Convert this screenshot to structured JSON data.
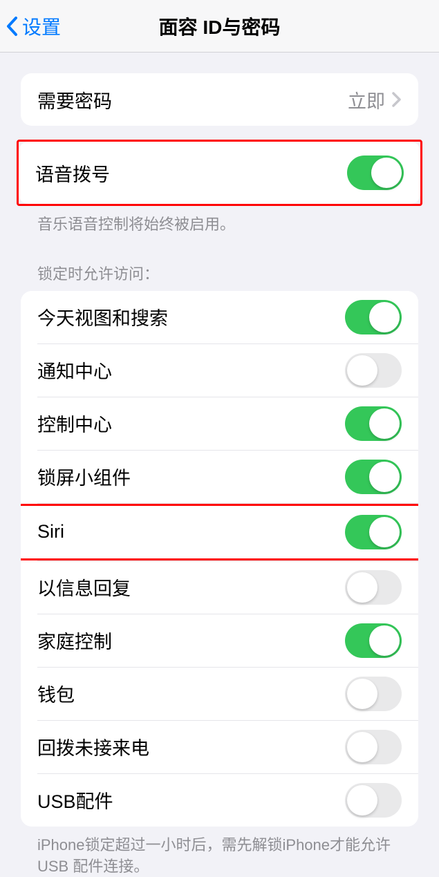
{
  "nav": {
    "back_label": "设置",
    "title": "面容 ID与密码"
  },
  "passcode_required": {
    "label": "需要密码",
    "value": "立即"
  },
  "voice_dial": {
    "label": "语音拨号",
    "footer": "音乐语音控制将始终被启用。"
  },
  "lock_access": {
    "header": "锁定时允许访问：",
    "items": [
      {
        "label": "今天视图和搜索",
        "on": true
      },
      {
        "label": "通知中心",
        "on": false
      },
      {
        "label": "控制中心",
        "on": true
      },
      {
        "label": "锁屏小组件",
        "on": true
      },
      {
        "label": "Siri",
        "on": true
      },
      {
        "label": "以信息回复",
        "on": false
      },
      {
        "label": "家庭控制",
        "on": true
      },
      {
        "label": "钱包",
        "on": false
      },
      {
        "label": "回拨未接来电",
        "on": false
      },
      {
        "label": "USB配件",
        "on": false
      }
    ],
    "footer": "iPhone锁定超过一小时后，需先解锁iPhone才能允许 USB 配件连接。"
  }
}
